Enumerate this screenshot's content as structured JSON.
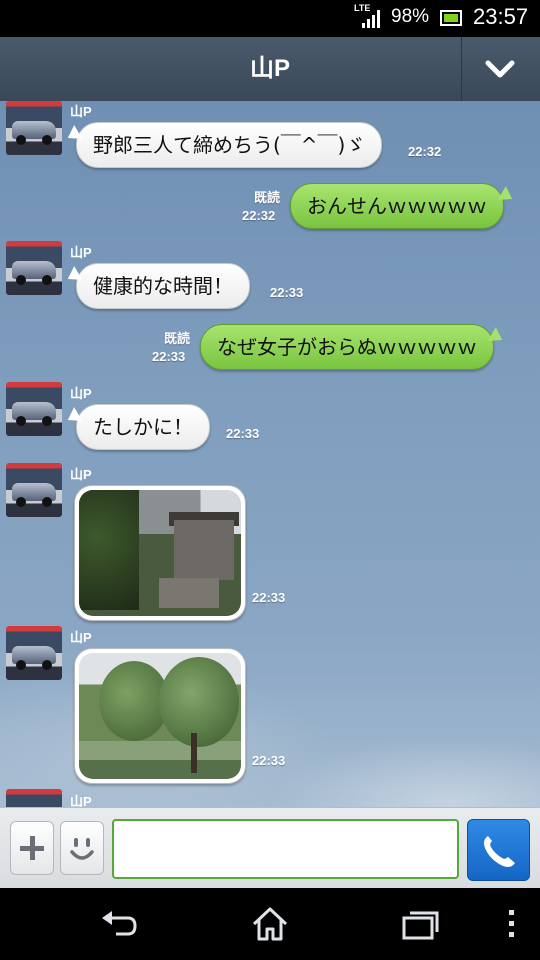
{
  "status": {
    "network": "LTE",
    "battery_pct": "98%",
    "time": "23:57"
  },
  "header": {
    "title": "山P"
  },
  "messages": [
    {
      "sender": "山P",
      "text": "野郎三人て締めちう(￣^￣)ゞ",
      "time": "22:32"
    },
    {
      "read": "既読",
      "text": "おんせんｗｗｗｗｗ",
      "time": "22:32"
    },
    {
      "sender": "山P",
      "text": "健康的な時間！",
      "time": "22:33"
    },
    {
      "read": "既読",
      "text": "なぜ女子がおらぬｗｗｗｗｗ",
      "time": "22:33"
    },
    {
      "sender": "山P",
      "text": "たしかに！",
      "time": "22:33"
    },
    {
      "sender": "山P",
      "photo": "ryokan-photo",
      "time": "22:33"
    },
    {
      "sender": "山P",
      "photo": "garden-photo",
      "time": "22:33"
    },
    {
      "sender": "山P"
    }
  ],
  "input": {
    "value": "",
    "placeholder": ""
  },
  "icons": {
    "plus": "plus-icon",
    "emoji": "smiley-icon",
    "call": "phone-icon",
    "dropdown": "chevron-down-icon",
    "back": "back-icon",
    "home": "home-icon",
    "recent": "recent-apps-icon",
    "menu": "menu-icon"
  },
  "colors": {
    "incoming_bubble": "#ffffff",
    "outgoing_bubble": "#8fd453",
    "header": "#435264",
    "call_button": "#1f77d6",
    "input_border": "#55a83a"
  }
}
